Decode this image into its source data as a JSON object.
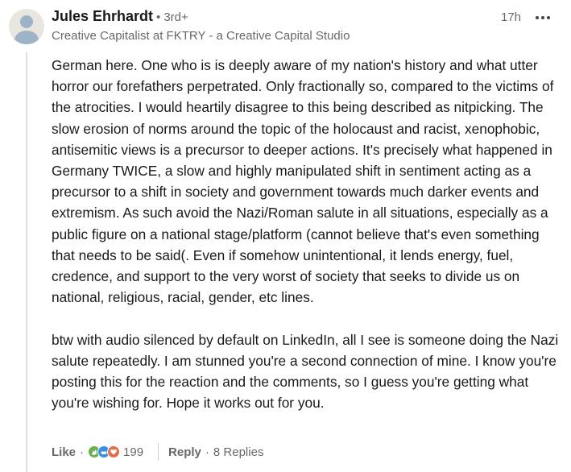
{
  "author": {
    "name": "Jules Ehrhardt",
    "degree": "3rd+",
    "separator": "•",
    "headline": "Creative Capitalist at FKTRY - a Creative Capital Studio"
  },
  "timestamp": "17h",
  "comment": {
    "paragraphs": [
      "German here. One who is is deeply aware of my nation's history and what utter horror our forefathers perpetrated. Only fractionally so, compared to the victims of the atrocities. I would heartily disagree to this being described as nitpicking. The slow erosion of norms around the topic of the holocaust and racist, xenophobic, antisemitic views is a precursor to deeper actions. It's precisely what happened in Germany TWICE, a slow and highly manipulated shift in sentiment acting as a precursor to a shift in society and government towards much darker events and extremism. As such avoid the Nazi/Roman salute in all situations, especially as a public figure on a national stage/platform (cannot believe that's even something that needs to be said(. Even if somehow unintentional, it lends energy, fuel, credence, and support to the very worst of society that seeks to divide us on national, religious, racial, gender, etc lines.",
      "btw with audio silenced by default on LinkedIn, all I see is someone doing the Nazi salute repeatedly. I am stunned you're a second connection of mine. I know you're posting this for the reaction and the comments, so I guess you're getting what you're wishing for. Hope it works out for you."
    ]
  },
  "actions": {
    "like_label": "Like",
    "dot": "·",
    "reaction_count": "199",
    "reply_label": "Reply",
    "replies_text": "8 Replies"
  },
  "reactions": [
    {
      "icon": "clap-icon",
      "color": "#6dae4f"
    },
    {
      "icon": "support-icon",
      "color": "#378fe9"
    },
    {
      "icon": "love-icon",
      "color": "#df704d"
    }
  ],
  "colors": {
    "text_primary": "#191919",
    "text_secondary": "#666666",
    "thread_line": "#e0e0e0",
    "avatar_bg": "#e9e5df",
    "avatar_figure": "#9db3c8"
  }
}
